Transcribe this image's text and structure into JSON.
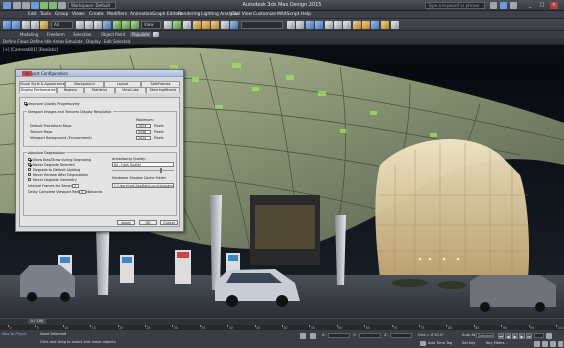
{
  "window": {
    "title": "Autodesk 3ds Max Design 2015",
    "workspace": "Workspace: Default",
    "search_placeholder": "Type a keyword or phrase",
    "controls": [
      "_",
      "□",
      "×"
    ]
  },
  "menu": [
    "Edit",
    "Tools",
    "Group",
    "Views",
    "Create",
    "Modifiers",
    "Animation",
    "Graph Editors",
    "Rendering",
    "Lighting Analysis",
    "Civil View",
    "Customize",
    "MAXScript",
    "Help"
  ],
  "toolbar": {
    "selection_filter": "All",
    "view_combo": "View"
  },
  "ribbon": {
    "tabs": [
      "Modeling",
      "Freeform",
      "Selection",
      "Object Paint",
      "Populate"
    ],
    "selected": "Populate",
    "subtabs": [
      "Define Flows",
      "Define Idle Areas",
      "Simulate",
      "Display",
      "Edit Selected"
    ]
  },
  "viewport": {
    "label": "[+] [Camera001] [Realistic]"
  },
  "dialog": {
    "title": "Viewport Configuration",
    "tabs_row1": [
      "Visual Style & Appearance",
      "Background",
      "Layout",
      "SafeFrames"
    ],
    "tabs_row2": [
      "Display Performance",
      "Regions",
      "Statistics",
      "ViewCube",
      "SteeringWheels"
    ],
    "improve_quality": "Improve Quality Progressively",
    "textures_group": "Viewport Images and Textures Display Resolution",
    "maximum_label": "Maximum:",
    "rows": [
      {
        "label": "Default Procedural Maps",
        "value": "1024",
        "unit": "Pixels"
      },
      {
        "label": "Texture Maps",
        "value": "2048",
        "unit": "Pixels"
      },
      {
        "label": "Viewport Background (Environment)",
        "value": "1024",
        "unit": "Pixels"
      }
    ],
    "adaptive_group": "Adaptive Degradation",
    "adaptive_options": [
      {
        "label": "Show Bias/Draw during Degrading",
        "checked": true
      },
      {
        "label": "Never Degrade Selected",
        "checked": true
      },
      {
        "label": "Degrade to Default Lighting",
        "checked": false
      },
      {
        "label": "Never Redraw After Degradation",
        "checked": false
      },
      {
        "label": "Never Degrade Geometry",
        "checked": false
      }
    ],
    "interval_label": "Interval Frames for Seconds:",
    "interval_value": "2",
    "radius_label": "Delay Complete Viewport Redraw in",
    "radius_value": "0",
    "radius_unit": "Seconds",
    "antialias_label": "Antialiasing Quality:",
    "antialias_value": "8X - High Quality",
    "shadow_label": "Hardware Shadow Cache Folder",
    "shadow_path": "C:\\Users\\test\\AppData\\Local\\Autodesk\\3ds",
    "buttons": {
      "apply": "Apply",
      "ok": "OK",
      "cancel": "Cancel"
    }
  },
  "timeline": {
    "frame_readout": "0 / 100",
    "ticks": [
      "0",
      "5",
      "10",
      "15",
      "20",
      "25",
      "30",
      "35",
      "40",
      "45",
      "50",
      "55",
      "60",
      "65",
      "70",
      "75",
      "80",
      "85",
      "90",
      "95",
      "100"
    ]
  },
  "status": {
    "max_to_physical": "Max to Physic",
    "none_selected": "None Selected",
    "prompt": "Click and drag to select and move objects",
    "coords": {
      "x_label": "X:",
      "x": "",
      "y_label": "Y:",
      "y": "",
      "z_label": "Z:",
      "z": ""
    },
    "grid": "Grid = 0'10.0\"",
    "add_time_tag": "Add Time Tag",
    "auto_key": "Auto Key",
    "set_key": "Set Key",
    "selected": "Selected",
    "key_filters": "Key Filters..."
  },
  "colors": {
    "accent": "#6a9bd8",
    "panel": "#d8d8d8",
    "ui_dark": "#3a3d42"
  }
}
